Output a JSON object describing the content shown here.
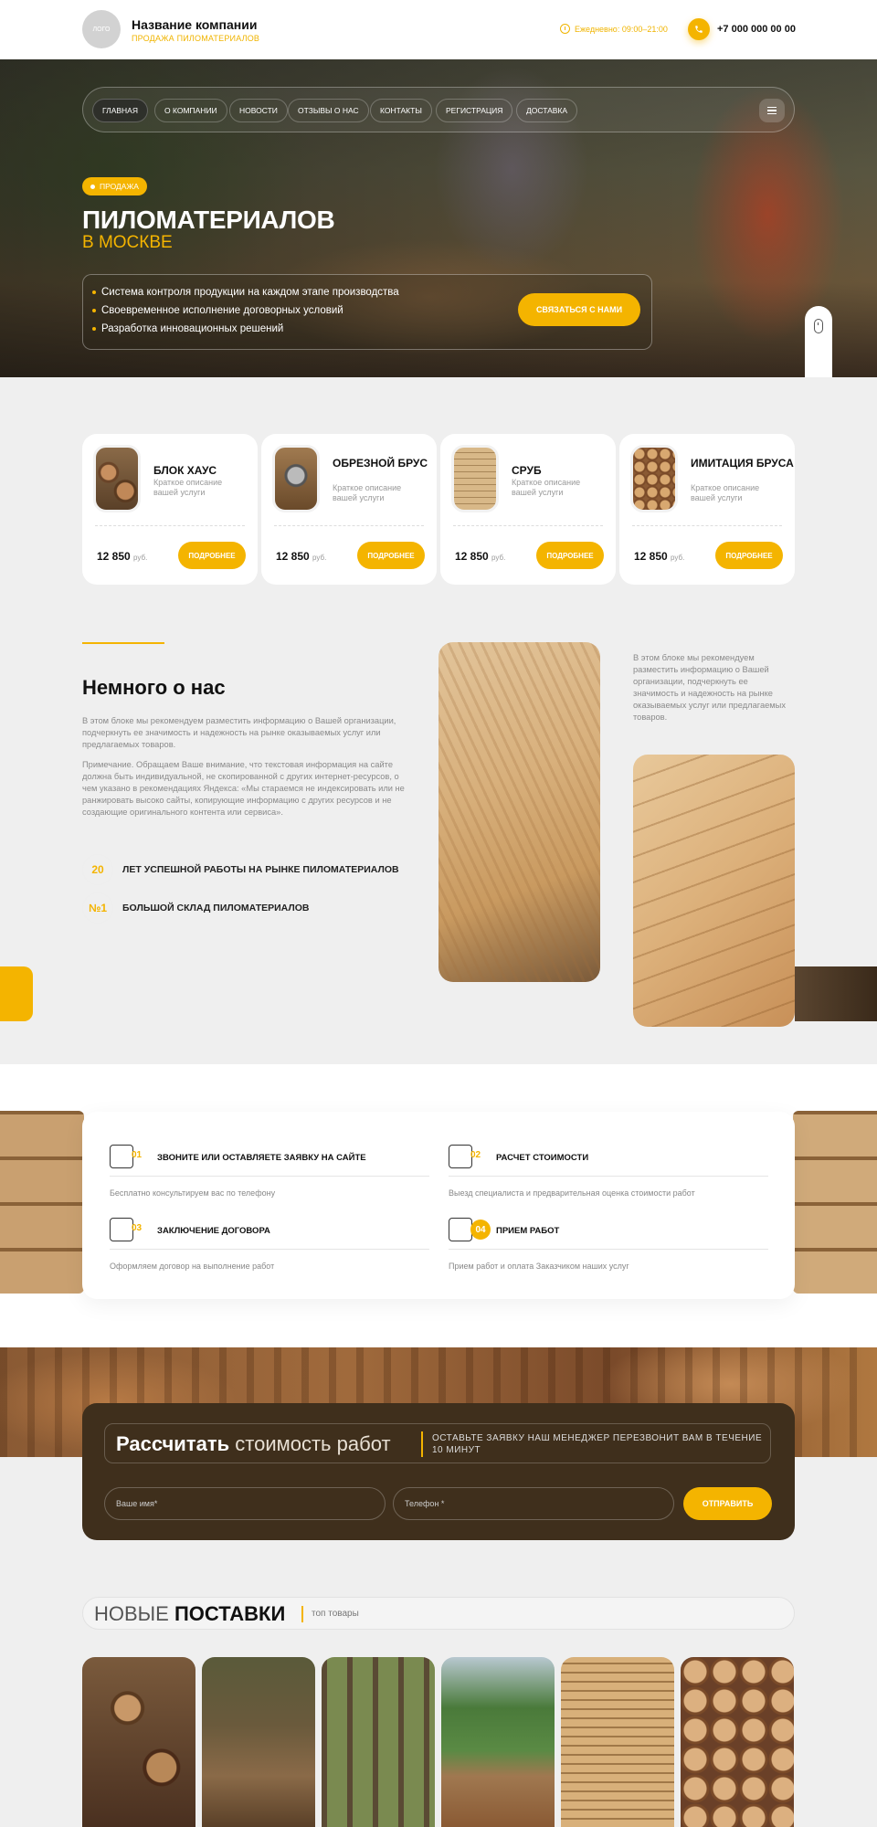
{
  "header": {
    "logo": "ЛОГО",
    "company": "Название компании",
    "tagline": "ПРОДАЖА ПИЛОМАТЕРИАЛОВ",
    "hours": "Ежедневно: 09:00–21:00",
    "phone": "+7 000 000 00 00"
  },
  "nav": {
    "items": [
      "ГЛАВНАЯ",
      "О КОМПАНИИ",
      "НОВОСТИ",
      "ОТЗЫВЫ О НАС",
      "КОНТАКТЫ",
      "РЕГИСТРАЦИЯ",
      "ДОСТАВКА"
    ]
  },
  "hero": {
    "badge": "ПРОДАЖА",
    "title": "ПИЛОМАТЕРИАЛОВ",
    "subtitle": "В МОСКВЕ",
    "features": [
      "Система контроля продукции на каждом этапе производства",
      "Своевременное исполнение договорных условий",
      "Разработка инновационных решений"
    ],
    "cta": "СВЯЗАТЬСЯ С НАМИ"
  },
  "products": [
    {
      "title": "БЛОК ХАУС",
      "desc": "Краткое описание вашей услуги",
      "price": "12 850",
      "unit": "руб.",
      "button": "ПОДРОБНЕЕ"
    },
    {
      "title": "ОБРЕЗНОЙ БРУС",
      "desc": "Краткое описание вашей услуги",
      "price": "12 850",
      "unit": "руб.",
      "button": "ПОДРОБНЕЕ"
    },
    {
      "title": "СРУБ",
      "desc": "Краткое описание вашей услуги",
      "price": "12 850",
      "unit": "руб.",
      "button": "ПОДРОБНЕЕ"
    },
    {
      "title": "ИМИТАЦИЯ БРУСА",
      "desc": "Краткое описание вашей услуги",
      "price": "12 850",
      "unit": "руб.",
      "button": "ПОДРОБНЕЕ"
    }
  ],
  "about": {
    "title": "Немного о нас",
    "p1": "В этом блоке мы рекомендуем разместить информацию о Вашей организации, подчеркнуть ее значимость и надежность на рынке оказываемых услуг или предлагаемых товаров.",
    "p2": "Примечание. Обращаем Ваше внимание, что текстовая информация на сайте должна быть индивидуальной, не скопированной с других интернет-ресурсов, о чем указано в рекомендациях Яндекса: «Мы стараемся не индексировать или не ранжировать высоко сайты, копирующие информацию с других ресурсов и не создающие оригинального контента или сервиса».",
    "side": "В этом блоке мы рекомендуем разместить информацию о Вашей организации, подчеркнуть ее значимость и надежность на рынке оказываемых услуг или предлагаемых товаров.",
    "stats": [
      {
        "num": "20",
        "text": "ЛЕТ УСПЕШНОЙ РАБОТЫ НА РЫНКЕ ПИЛОМАТЕРИАЛОВ"
      },
      {
        "num": "№1",
        "text": "БОЛЬШОЙ СКЛАД ПИЛОМАТЕРИАЛОВ"
      }
    ]
  },
  "steps": [
    {
      "num": "01",
      "title": "ЗВОНИТЕ ИЛИ ОСТАВЛЯЕТЕ ЗАЯВКУ НА САЙТЕ",
      "desc": "Бесплатно консультируем вас по телефону"
    },
    {
      "num": "02",
      "title": "РАСЧЕТ СТОИМОСТИ",
      "desc": "Выезд специалиста и предварительная оценка стоимости работ"
    },
    {
      "num": "03",
      "title": "ЗАКЛЮЧЕНИЕ ДОГОВОРА",
      "desc": "Оформляем договор на выполнение работ"
    },
    {
      "num": "04",
      "title": "ПРИЕМ РАБОТ",
      "desc": "Прием работ и оплата Заказчиком наших услуг"
    }
  ],
  "calc": {
    "title_bold": "Рассчитать",
    "title_light": "стоимость работ",
    "note": "ОСТАВЬТЕ ЗАЯВКУ НАШ МЕНЕДЖЕР ПЕРЕЗВОНИТ ВАМ В ТЕЧЕНИЕ 10 МИНУТ",
    "name_placeholder": "Ваше имя*",
    "phone_placeholder": "Телефон *",
    "submit": "ОТПРАВИТЬ"
  },
  "new": {
    "title_light": "НОВЫЕ",
    "title_bold": "ПОСТАВКИ",
    "sub": "топ товары"
  },
  "colors": {
    "accent": "#f4b400",
    "dark_box": "#3f2f1c"
  }
}
